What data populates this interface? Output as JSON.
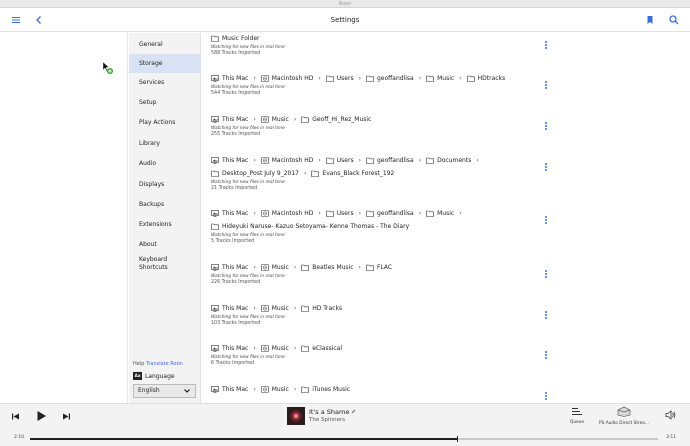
{
  "window": {
    "title": "Roon"
  },
  "header": {
    "title": "Settings",
    "accent": "#3b6fd8"
  },
  "nav": {
    "items": [
      {
        "label": "General"
      },
      {
        "label": "Storage",
        "selected": true
      },
      {
        "label": "Services"
      },
      {
        "label": "Setup"
      },
      {
        "label": "Play Actions"
      },
      {
        "label": "Library"
      },
      {
        "label": "Audio"
      },
      {
        "label": "Displays"
      },
      {
        "label": "Backups"
      },
      {
        "label": "Extensions"
      },
      {
        "label": "About"
      },
      {
        "label": "Keyboard Shortcuts"
      }
    ],
    "help": "Help",
    "translate": "Translate Roon",
    "language_label": "Language",
    "language_badge": "Aa",
    "language_value": "English"
  },
  "folders": [
    {
      "line1": [
        {
          "icon": "folder",
          "text": "Music Folder"
        }
      ],
      "status": "Watching for new files in real time",
      "count": "588 Tracks Imported"
    },
    {
      "line1": [
        {
          "icon": "computer",
          "text": "This Mac"
        },
        {
          "icon": "drive",
          "text": "Macintosh HD"
        },
        {
          "icon": "folder",
          "text": "Users"
        },
        {
          "icon": "folder",
          "text": "geoffandlisa"
        },
        {
          "icon": "folder",
          "text": "Music"
        },
        {
          "icon": "folder",
          "text": "HDtracks"
        }
      ],
      "status": "Watching for new files in real time",
      "count": "544 Tracks Imported"
    },
    {
      "line1": [
        {
          "icon": "computer",
          "text": "This Mac"
        },
        {
          "icon": "drive",
          "text": "Music"
        },
        {
          "icon": "folder",
          "text": "Geoff_Hi_Rez_Music"
        }
      ],
      "status": "Watching for new files in real time",
      "count": "255 Tracks Imported"
    },
    {
      "line1": [
        {
          "icon": "computer",
          "text": "This Mac"
        },
        {
          "icon": "drive",
          "text": "Macintosh HD"
        },
        {
          "icon": "folder",
          "text": "Users"
        },
        {
          "icon": "folder",
          "text": "geoffandlisa"
        },
        {
          "icon": "folder",
          "text": "Documents"
        }
      ],
      "line1_trailing_sep": true,
      "line2": [
        {
          "icon": "folder",
          "text": "Desktop_Post July 9_2017"
        },
        {
          "icon": "folder",
          "text": "Evans_Black Forest_192"
        }
      ],
      "status": "Watching for new files in real time",
      "count": "21 Tracks Imported"
    },
    {
      "line1": [
        {
          "icon": "computer",
          "text": "This Mac"
        },
        {
          "icon": "drive",
          "text": "Macintosh HD"
        },
        {
          "icon": "folder",
          "text": "Users"
        },
        {
          "icon": "folder",
          "text": "geoffandlisa"
        },
        {
          "icon": "folder",
          "text": "Music"
        }
      ],
      "line1_trailing_sep": true,
      "line2": [
        {
          "icon": "folder",
          "text": "Hideyuki Naruse- Kazuo Setoyama- Kenne Thomas - The Diary"
        }
      ],
      "status": "Watching for new files in real time",
      "count": "5 Tracks Imported"
    },
    {
      "line1": [
        {
          "icon": "computer",
          "text": "This Mac"
        },
        {
          "icon": "drive",
          "text": "Music"
        },
        {
          "icon": "folder",
          "text": "Beatles Music"
        },
        {
          "icon": "folder",
          "text": "FLAC"
        }
      ],
      "status": "Watching for new files in real time",
      "count": "226 Tracks Imported"
    },
    {
      "line1": [
        {
          "icon": "computer",
          "text": "This Mac"
        },
        {
          "icon": "drive",
          "text": "Music"
        },
        {
          "icon": "folder",
          "text": "HD Tracks"
        }
      ],
      "status": "Watching for new files in real time",
      "count": "103 Tracks Imported"
    },
    {
      "line1": [
        {
          "icon": "computer",
          "text": "This Mac"
        },
        {
          "icon": "drive",
          "text": "Music"
        },
        {
          "icon": "folder",
          "text": "eClassical"
        }
      ],
      "status": "Watching for new files in real time",
      "count": "6 Tracks Imported"
    },
    {
      "line1": [
        {
          "icon": "computer",
          "text": "This Mac"
        },
        {
          "icon": "drive",
          "text": "Music"
        },
        {
          "icon": "folder",
          "text": "iTunes Music"
        }
      ],
      "status": "",
      "count": ""
    }
  ],
  "player": {
    "track": "It's a Shame",
    "artist": "The Spinners",
    "elapsed": "2:10",
    "duration": "3:11",
    "progress_fraction": 0.68,
    "queue_label": "Queue",
    "zone_label": "PS Audio Direct Strea..."
  }
}
